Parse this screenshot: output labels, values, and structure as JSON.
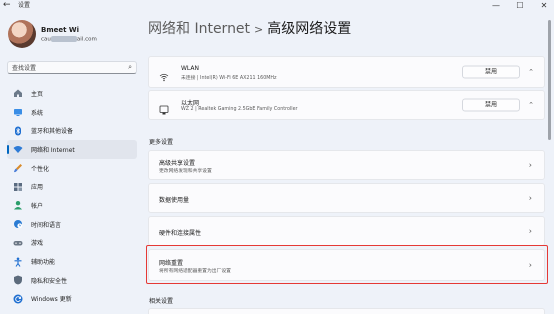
{
  "window": {
    "title": "设置",
    "back": "←",
    "minimize": "—",
    "maximize": "☐",
    "close": "✕"
  },
  "user": {
    "name": "Bmeet Wi",
    "email_suffix": "ail.com",
    "email_prefix": "cau"
  },
  "search": {
    "placeholder": "查找设置"
  },
  "sidebar": {
    "items": [
      {
        "label": "主页",
        "icon": "home-icon"
      },
      {
        "label": "系统",
        "icon": "system-icon"
      },
      {
        "label": "蓝牙和其他设备",
        "icon": "bluetooth-icon"
      },
      {
        "label": "网络和 Internet",
        "icon": "wifi-icon",
        "active": true
      },
      {
        "label": "个性化",
        "icon": "brush-icon"
      },
      {
        "label": "应用",
        "icon": "apps-icon"
      },
      {
        "label": "帐户",
        "icon": "account-icon"
      },
      {
        "label": "时间和语言",
        "icon": "globe-clock-icon"
      },
      {
        "label": "游戏",
        "icon": "gamepad-icon"
      },
      {
        "label": "辅助功能",
        "icon": "accessibility-icon"
      },
      {
        "label": "隐私和安全性",
        "icon": "shield-icon"
      },
      {
        "label": "Windows 更新",
        "icon": "update-icon"
      }
    ]
  },
  "header": {
    "crumb": "网络和 Internet",
    "separator": ">",
    "title": "高级网络设置"
  },
  "adapters": [
    {
      "name": "WLAN",
      "desc": "未连接 | Intel(R) Wi-Fi 6E AX211 160MHz",
      "button": "禁用",
      "icon": "wifi-icon"
    },
    {
      "name": "以太网",
      "desc": "WZ 2 | Realtek Gaming 2.5GbE Family Controller",
      "button": "禁用",
      "icon": "ethernet-icon"
    }
  ],
  "more_settings": {
    "label": "更多设置",
    "items": [
      {
        "title": "高级共享设置",
        "desc": "更改网络发现和共享设置"
      },
      {
        "title": "数据使用量",
        "desc": ""
      },
      {
        "title": "硬件和连接属性",
        "desc": ""
      },
      {
        "title": "网络重置",
        "desc": "将所有网络适配器重置为出厂设置"
      }
    ]
  },
  "related_settings": {
    "label": "相关设置"
  },
  "colors": {
    "accent": "#0067c0",
    "highlight": "#e53935",
    "background": "#eef2f9"
  }
}
